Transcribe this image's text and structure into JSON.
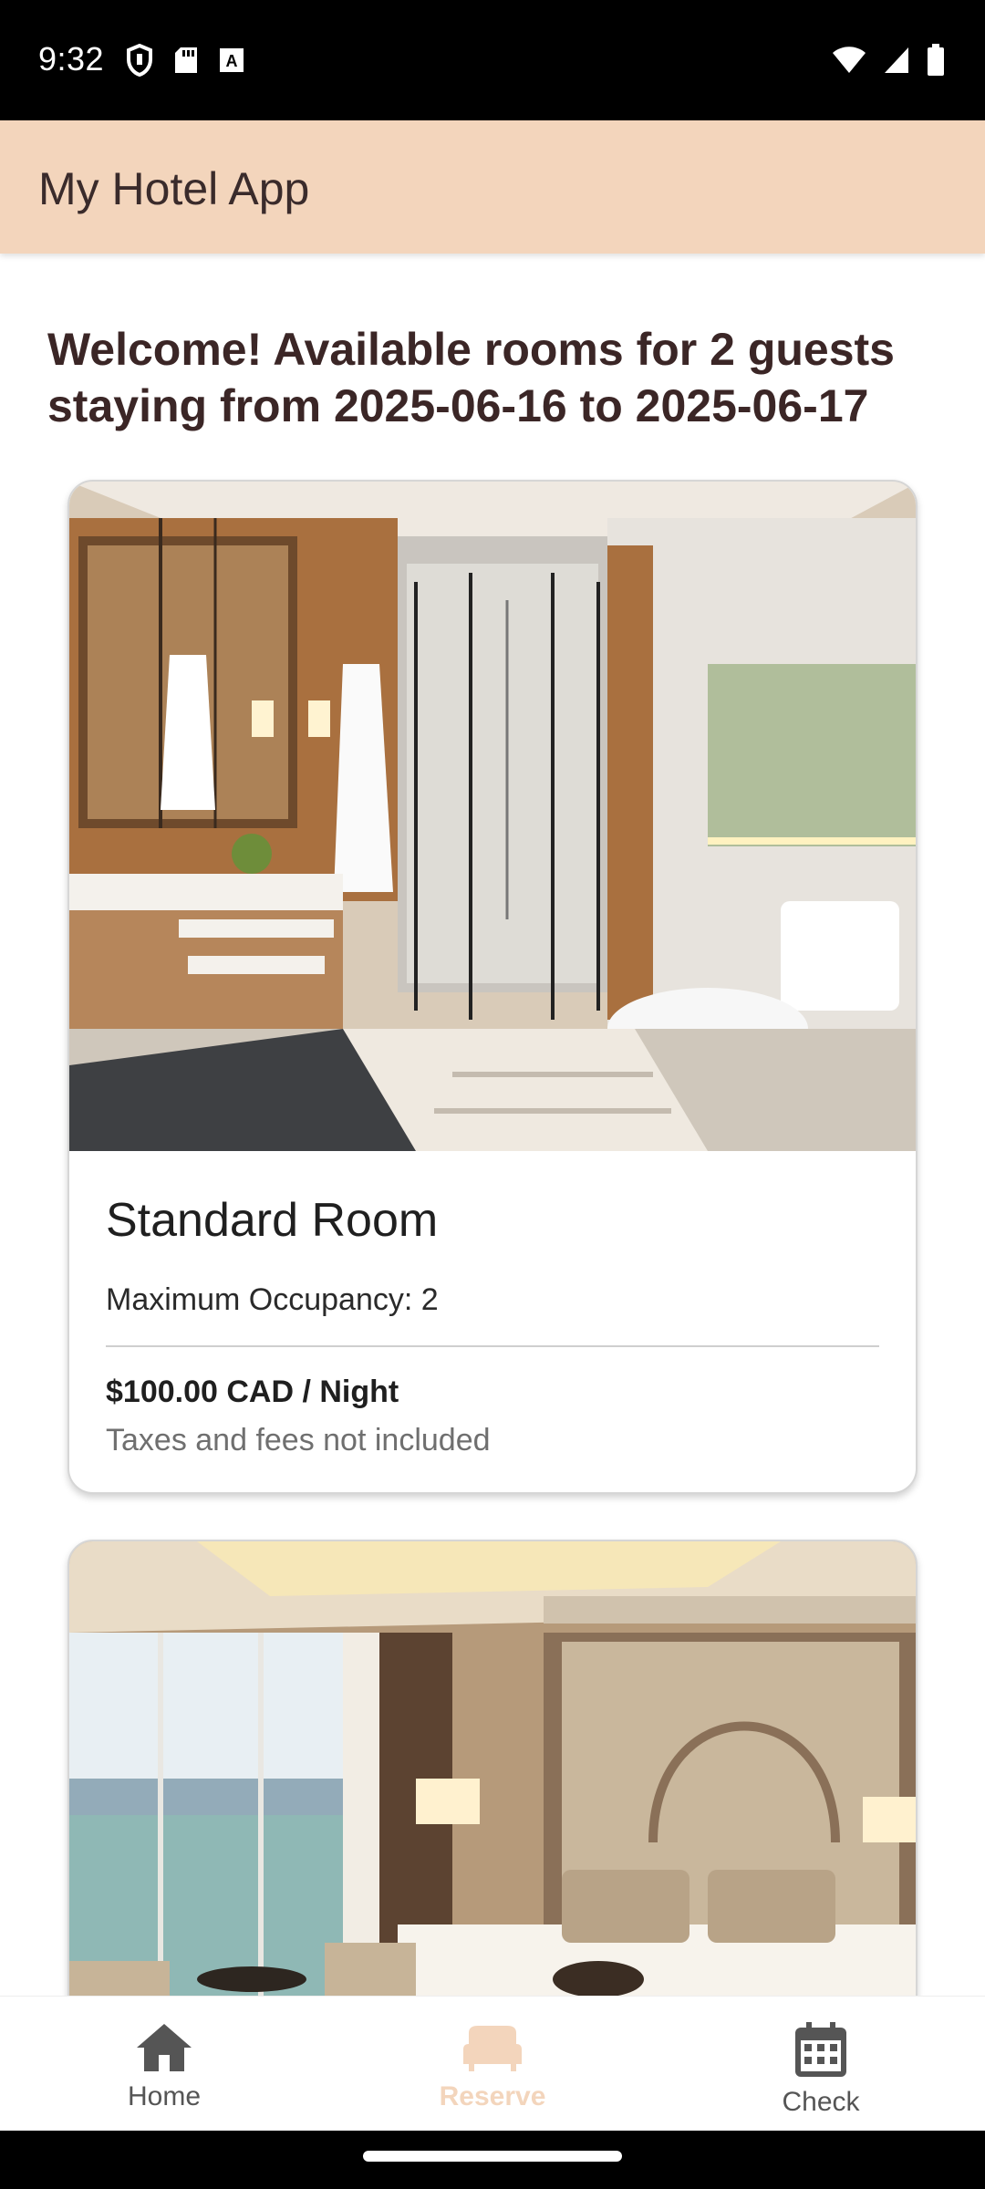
{
  "status_bar": {
    "time": "9:32",
    "left_icons": [
      "shield-icon",
      "sd-card-icon",
      "keyboard-a-icon"
    ],
    "right_icons": [
      "wifi-icon",
      "cellular-signal-icon",
      "battery-icon"
    ]
  },
  "app_bar": {
    "title": "My Hotel App",
    "background_color": "#f3d5bc"
  },
  "content": {
    "welcome_text": "Welcome! Available rooms for 2 guests staying from 2025-06-16 to 2025-06-17",
    "rooms": [
      {
        "name": "Standard Room",
        "occupancy": "Maximum Occupancy: 2",
        "price": "$100.00 CAD / Night",
        "taxes_note": "Taxes and fees not included",
        "image_icon": "bathroom-photo"
      },
      {
        "image_icon": "bedroom-ocean-view-photo"
      }
    ]
  },
  "bottom_nav": {
    "items": [
      {
        "label": "Home",
        "icon": "home-icon",
        "active": false
      },
      {
        "label": "Reserve",
        "icon": "bed-icon",
        "active": true
      },
      {
        "label": "Check",
        "icon": "calendar-icon",
        "active": false
      }
    ],
    "active_color": "#f3d5bc"
  }
}
